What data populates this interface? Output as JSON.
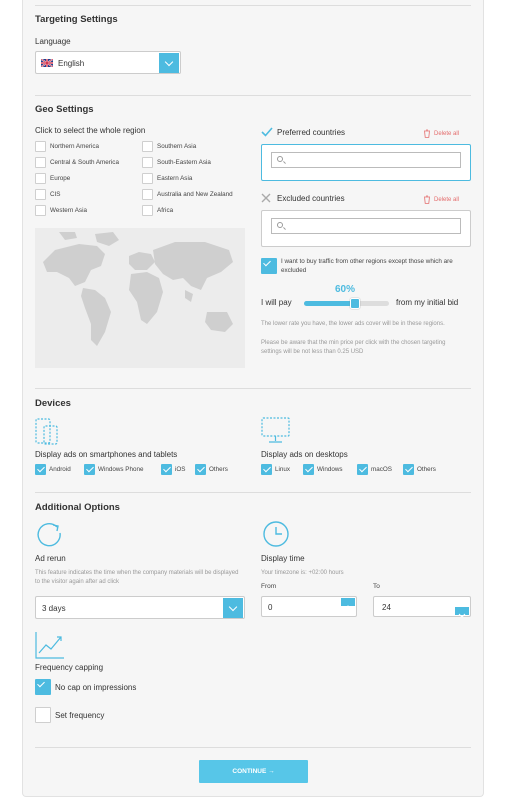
{
  "targeting": {
    "title": "Targeting Settings",
    "language_label": "Language",
    "language_value": "English"
  },
  "geo": {
    "title": "Geo Settings",
    "region_hint": "Click to select the whole region",
    "regions": [
      {
        "label": "Northern America",
        "checked": false
      },
      {
        "label": "Southern Asia",
        "checked": false
      },
      {
        "label": "Central & South America",
        "checked": false
      },
      {
        "label": "South-Eastern Asia",
        "checked": false
      },
      {
        "label": "Europe",
        "checked": false
      },
      {
        "label": "Eastern Asia",
        "checked": false
      },
      {
        "label": "CIS",
        "checked": false
      },
      {
        "label": "Australia and New Zealand",
        "checked": false
      },
      {
        "label": "Western Asia",
        "checked": false
      },
      {
        "label": "Africa",
        "checked": false
      }
    ],
    "preferred_title": "Preferred countries",
    "excluded_title": "Excluded countries",
    "delete_all": "Delete all",
    "buy_other_label": "I want to buy traffic from other regions except those which are excluded",
    "buy_other_checked": true,
    "pay_prefix": "I will pay",
    "pay_suffix": "from my initial bid",
    "pay_percent_text": "60%",
    "pay_fraction": 0.6,
    "note_line1": "The lower rate you have, the lower ads cover will be in these regions.",
    "note_line2": "Please be aware that the min price per click with the chosen targeting settings will be not less than 0.25 USD"
  },
  "devices": {
    "title": "Devices",
    "mobile_label": "Display ads on smartphones and tablets",
    "desktop_label": "Display ads on desktops",
    "mobile_os": [
      {
        "label": "Android",
        "checked": true
      },
      {
        "label": "Windows Phone",
        "checked": true
      },
      {
        "label": "iOS",
        "checked": true
      },
      {
        "label": "Others",
        "checked": true
      }
    ],
    "desktop_os": [
      {
        "label": "Linux",
        "checked": true
      },
      {
        "label": "Windows",
        "checked": true
      },
      {
        "label": "macOS",
        "checked": true
      },
      {
        "label": "Others",
        "checked": true
      }
    ]
  },
  "additional": {
    "title": "Additional Options",
    "rerun_title": "Ad rerun",
    "rerun_note": "This feature indicates the time when the company materials will be displayed to the visitor again after ad click",
    "rerun_value": "3 days",
    "display_time_title": "Display time",
    "timezone_note": "Your timezone is: +02:00 hours",
    "from_label": "From",
    "from_value": "0",
    "to_label": "To",
    "to_value": "24",
    "freq_title": "Frequency capping",
    "no_cap_label": "No cap on impressions",
    "no_cap_checked": true,
    "set_freq_label": "Set frequency",
    "set_freq_checked": false
  },
  "continue_label": "CONTINUE →",
  "colors": {
    "accent": "#4dbbe0",
    "danger": "#e46c6c"
  },
  "icons": [
    "uk-flag-icon",
    "check-icon",
    "close-icon",
    "trash-icon",
    "search-icon",
    "world-map",
    "tablet-icon",
    "desktop-icon",
    "rerun-icon",
    "clock-icon",
    "chart-icon"
  ]
}
